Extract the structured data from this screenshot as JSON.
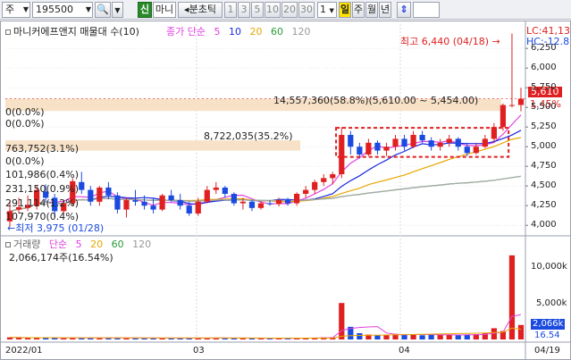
{
  "toolbar": {
    "market_select": "주",
    "code_input": "195500",
    "search_icon": "search-icon",
    "zoom_icon": "magnifier-icon",
    "new_button": "신",
    "name_label": "마니",
    "period_arrow": "◂",
    "period_label": "분초틱",
    "intervals": [
      "1",
      "3",
      "5",
      "10",
      "20",
      "30"
    ],
    "count_input": "1",
    "period_tabs": [
      "일",
      "주",
      "월",
      "년"
    ],
    "updown_icon": "updown-arrow-icon"
  },
  "price_panel": {
    "title": "마니커에프앤지 매물대 수(10)",
    "ma_title": "종가 단순",
    "ma_periods": [
      "5",
      "10",
      "20",
      "60",
      "120"
    ],
    "ma_colors": [
      "#e040e0",
      "#1a2ae0",
      "#e8a600",
      "#2a9a3a",
      "#aaaaaa"
    ],
    "lc_label": "LC:41,13",
    "hc_label": "HC:-12.8",
    "high_label": "최고 6,440 (04/18)",
    "low_label": "최저 3,975 (01/28)",
    "current_price": "5,610",
    "current_change": "1.45%",
    "y_ticks": [
      "6,250",
      "6,000",
      "5,750",
      "5,500",
      "5,250",
      "5,000",
      "4,750",
      "4,500",
      "4,250",
      "4,000"
    ],
    "volume_profile_labels": [
      "0(0.0%)",
      "0(0.0%)",
      "763,752(3.1%)",
      "0(0.0%)",
      "101,986(0.4%)",
      "231,150(0.9%)",
      "291,114(1.2%)",
      "107,970(0.4%)"
    ],
    "vp_main_label": "14,557,360(58.8%)(5,610.00 ~ 5,454.00)",
    "vp_second_label": "8,722,035(35.2%)"
  },
  "volume_panel": {
    "title": "거래량",
    "ma_title": "단순",
    "ma_periods": [
      "5",
      "20",
      "60",
      "120"
    ],
    "ma_colors": [
      "#e040e0",
      "#e8a600",
      "#2a9a3a",
      "#aaaaaa"
    ],
    "volume_text": "2,066,174주(16.54%)",
    "y_ticks": [
      "10,000k",
      "5,000k"
    ],
    "current_volume": "2,066k",
    "current_pct": "16.54"
  },
  "x_axis": {
    "labels": [
      "2022/01",
      "03",
      "04",
      "04/19"
    ]
  },
  "chart_data": {
    "type": "candlestick",
    "ylim": [
      3900,
      6400
    ],
    "candles": [
      [
        4050,
        4300,
        3975,
        4180
      ],
      [
        4200,
        4350,
        4150,
        4230
      ],
      [
        4220,
        4380,
        4180,
        4260
      ],
      [
        4250,
        4500,
        4200,
        4450
      ],
      [
        4430,
        4520,
        4300,
        4350
      ],
      [
        4350,
        4400,
        4100,
        4180
      ],
      [
        4180,
        4320,
        4120,
        4280
      ],
      [
        4280,
        4600,
        4250,
        4560
      ],
      [
        4550,
        4680,
        4400,
        4450
      ],
      [
        4450,
        4500,
        4250,
        4300
      ],
      [
        4300,
        4500,
        4250,
        4480
      ],
      [
        4480,
        4550,
        4330,
        4380
      ],
      [
        4380,
        4420,
        4150,
        4200
      ],
      [
        4200,
        4350,
        4100,
        4320
      ],
      [
        4320,
        4450,
        4250,
        4300
      ],
      [
        4300,
        4380,
        4200,
        4250
      ],
      [
        4250,
        4350,
        4150,
        4200
      ],
      [
        4200,
        4400,
        4180,
        4380
      ],
      [
        4380,
        4450,
        4300,
        4320
      ],
      [
        4320,
        4400,
        4200,
        4250
      ],
      [
        4250,
        4300,
        4120,
        4150
      ],
      [
        4150,
        4350,
        4120,
        4300
      ],
      [
        4300,
        4500,
        4280,
        4450
      ],
      [
        4450,
        4550,
        4400,
        4480
      ],
      [
        4480,
        4500,
        4350,
        4400
      ],
      [
        4400,
        4420,
        4250,
        4280
      ],
      [
        4280,
        4350,
        4200,
        4300
      ],
      [
        4300,
        4320,
        4180,
        4220
      ],
      [
        4220,
        4300,
        4200,
        4280
      ],
      [
        4280,
        4320,
        4250,
        4270
      ],
      [
        4270,
        4350,
        4240,
        4320
      ],
      [
        4320,
        4350,
        4250,
        4280
      ],
      [
        4280,
        4420,
        4250,
        4400
      ],
      [
        4400,
        4500,
        4350,
        4450
      ],
      [
        4450,
        4580,
        4400,
        4550
      ],
      [
        4550,
        4650,
        4500,
        4600
      ],
      [
        4600,
        4680,
        4520,
        4650
      ],
      [
        4650,
        5250,
        4600,
        5150
      ],
      [
        5150,
        5200,
        4900,
        5000
      ],
      [
        5000,
        5050,
        4850,
        4900
      ],
      [
        4900,
        5100,
        4880,
        5050
      ],
      [
        5050,
        5080,
        4900,
        4950
      ],
      [
        4950,
        5050,
        4880,
        5000
      ],
      [
        5000,
        5150,
        4950,
        5100
      ],
      [
        5100,
        5150,
        4950,
        5000
      ],
      [
        5000,
        5200,
        4980,
        5150
      ],
      [
        5150,
        5200,
        5050,
        5080
      ],
      [
        5080,
        5120,
        4950,
        5000
      ],
      [
        5000,
        5100,
        4950,
        5050
      ],
      [
        5050,
        5150,
        5000,
        5100
      ],
      [
        5100,
        5120,
        4950,
        5000
      ],
      [
        5000,
        5050,
        4880,
        4920
      ],
      [
        4920,
        5050,
        4900,
        5000
      ],
      [
        5000,
        5150,
        4980,
        5100
      ],
      [
        5100,
        5300,
        5050,
        5250
      ],
      [
        5250,
        5550,
        5200,
        5530
      ],
      [
        5530,
        6440,
        5500,
        5530
      ],
      [
        5530,
        5750,
        5450,
        5610
      ]
    ],
    "volumes": [
      300,
      250,
      200,
      280,
      220,
      260,
      200,
      240,
      250,
      210,
      230,
      220,
      240,
      200,
      210,
      180,
      170,
      200,
      190,
      200,
      180,
      190,
      210,
      230,
      200,
      190,
      180,
      170,
      160,
      150,
      160,
      170,
      190,
      220,
      260,
      300,
      320,
      5200,
      1800,
      900,
      700,
      600,
      650,
      800,
      700,
      750,
      600,
      650,
      700,
      650,
      600,
      700,
      750,
      900,
      1600,
      1200,
      12000,
      2066
    ],
    "highlight_box": {
      "from_index": 37,
      "to_index": 55,
      "low": 4870,
      "high": 5240
    }
  }
}
